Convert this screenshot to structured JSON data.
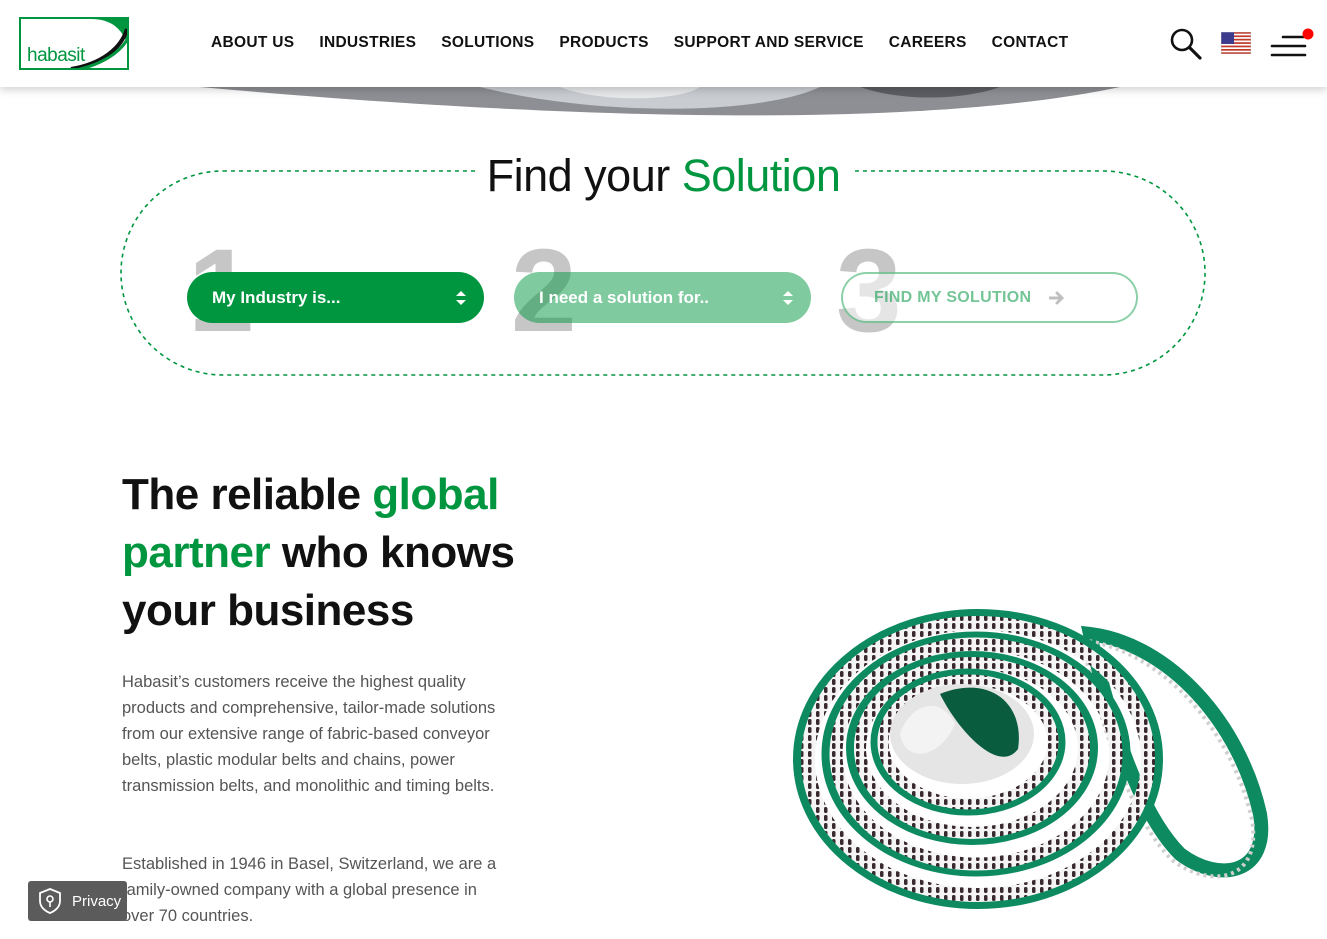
{
  "header": {
    "logo_text": "habasit",
    "nav": [
      "ABOUT US",
      "INDUSTRIES",
      "SOLUTIONS",
      "PRODUCTS",
      "SUPPORT AND SERVICE",
      "CAREERS",
      "CONTACT"
    ],
    "icons": {
      "search": "search-icon",
      "language": "us-flag-icon",
      "menu": "hamburger-menu-icon",
      "notification": "red-dot"
    }
  },
  "finder": {
    "title_plain": "Find your",
    "title_accent": "Solution",
    "steps": [
      {
        "number": "1",
        "label": "My Industry is..."
      },
      {
        "number": "2",
        "label": "I need a solution for.."
      },
      {
        "number": "3",
        "label": "FIND MY SOLUTION"
      }
    ]
  },
  "about": {
    "title_1": "The reliable ",
    "title_accent_1": "global",
    "title_accent_2": "partner",
    "title_2": " who knows your business",
    "paragraph_1": "Habasit’s customers receive the highest quality products and comprehensive, tailor-made solutions from our extensive range of fabric-based conveyor belts, plastic modular belts and chains, power transmission belts, and monolithic and timing belts.",
    "paragraph_2": "Established in 1946 in Basel, Switzerland, we are a family-owned company with a global presence in over 70 countries."
  },
  "privacy": {
    "label": "Privacy"
  },
  "colors": {
    "brand_green": "#00963f",
    "text": "#111111",
    "muted_text": "#555555",
    "privacy_bg": "#5b5b5b"
  }
}
